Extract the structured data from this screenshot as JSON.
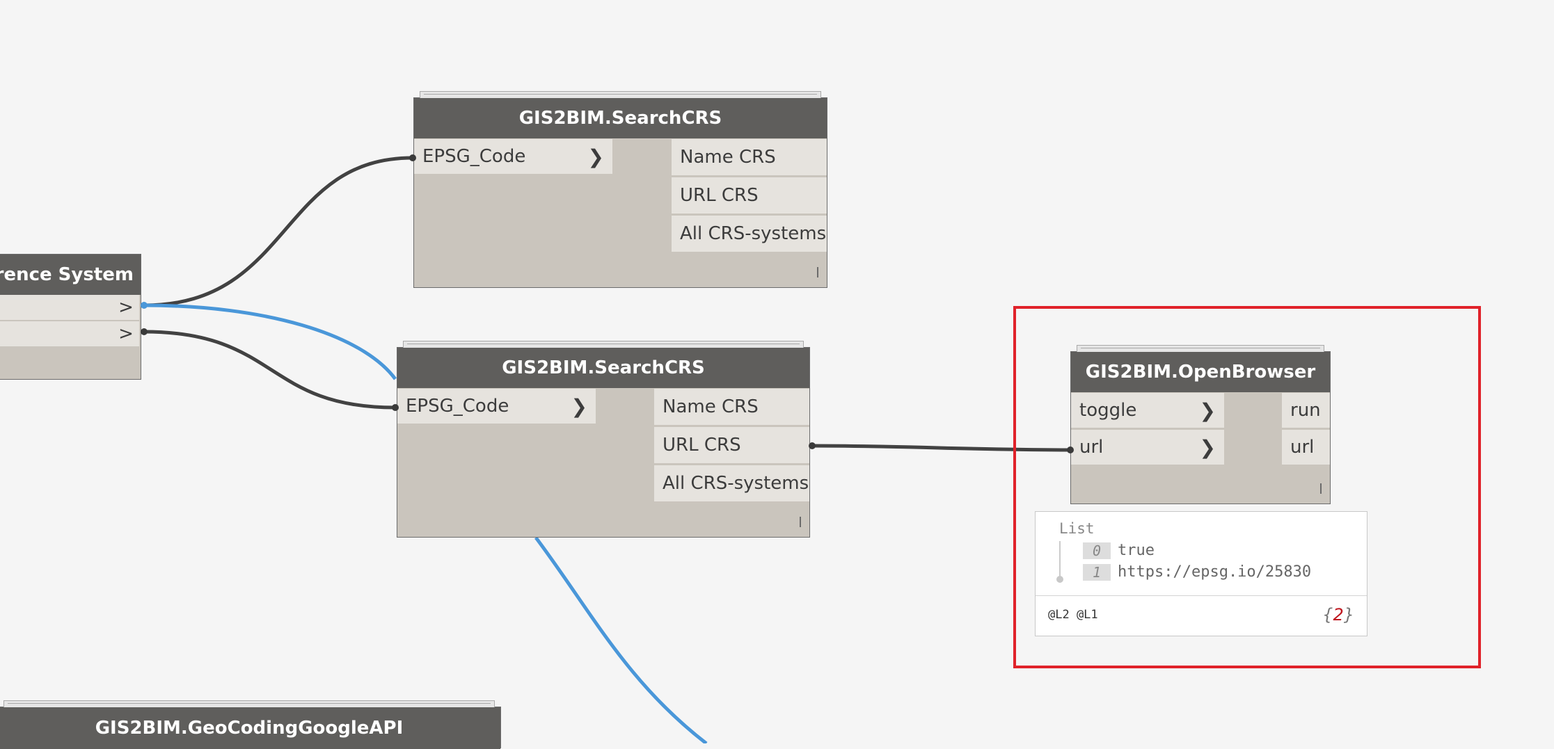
{
  "colors": {
    "canvas": "#f5f5f5",
    "node_header": "#5f5e5c",
    "node_body": "#cac5bd",
    "port": "#e6e3de",
    "wire_dark": "#424242",
    "wire_selected": "#4a97d9",
    "highlight": "#e0222a"
  },
  "nodes": {
    "crs_partial": {
      "title": "erence System",
      "outputs": [
        ">",
        ">"
      ]
    },
    "search_top": {
      "title": "GIS2BIM.SearchCRS",
      "input": "EPSG_Code",
      "input_icon": "chevron-right-icon",
      "outputs": [
        "Name CRS",
        "URL CRS",
        "All CRS-systems"
      ]
    },
    "search_mid": {
      "title": "GIS2BIM.SearchCRS",
      "input": "EPSG_Code",
      "input_icon": "chevron-right-icon",
      "outputs": [
        "Name CRS",
        "URL CRS",
        "All CRS-systems"
      ]
    },
    "open_browser": {
      "title": "GIS2BIM.OpenBrowser",
      "inputs": [
        "toggle",
        "url"
      ],
      "outputs": [
        "run",
        "url"
      ]
    },
    "geocoding": {
      "title": "GIS2BIM.GeoCodingGoogleAPI"
    }
  },
  "preview": {
    "title": "List",
    "items": [
      {
        "index": "0",
        "value": "true"
      },
      {
        "index": "1",
        "value": "https://epsg.io/25830"
      }
    ],
    "levels": "@L2 @L1",
    "count_open": "{",
    "count": "2",
    "count_close": "}"
  }
}
